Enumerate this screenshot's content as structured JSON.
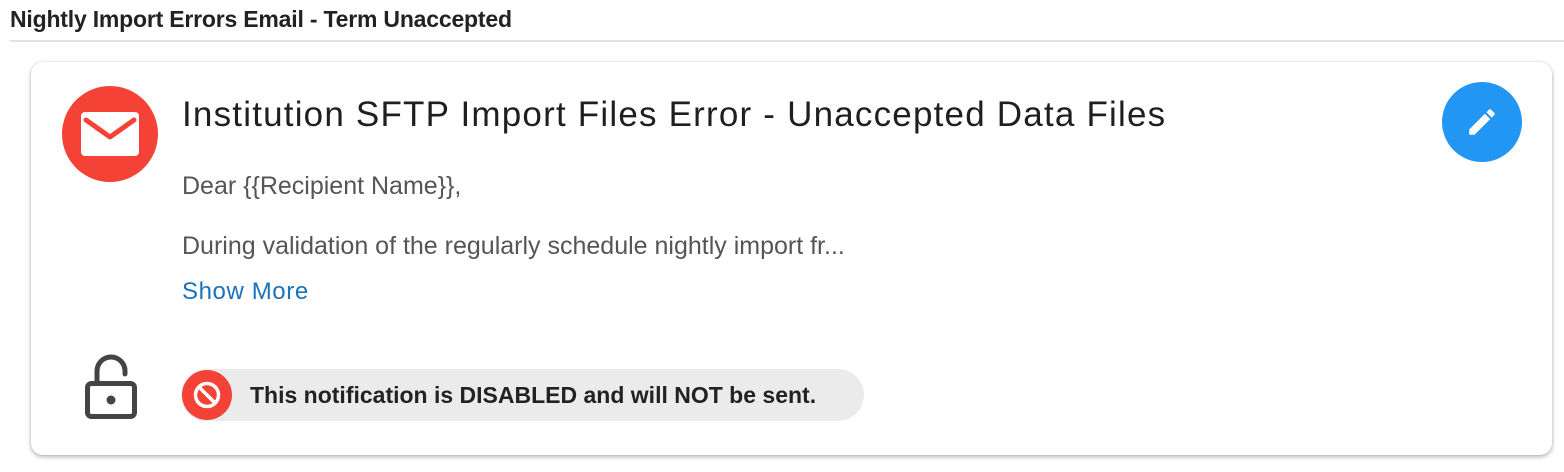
{
  "section": {
    "title": "Nightly Import Errors Email - Term Unaccepted"
  },
  "notification": {
    "icon": "mail-icon",
    "title": "Institution SFTP Import Files Error - Unaccepted Data Files",
    "greeting": "Dear {{Recipient Name}},",
    "excerpt": "During validation of the regularly schedule nightly import fr...",
    "show_more_label": "Show More",
    "edit_icon": "pencil-icon",
    "lock_icon": "lock-open-icon",
    "status": {
      "icon": "block-icon",
      "text": "This notification is DISABLED and will NOT be sent."
    }
  },
  "colors": {
    "mail_badge": "#f44336",
    "edit_button": "#2196f3",
    "link": "#1a73b8",
    "status_chip_bg": "#ebebeb",
    "status_icon": "#f44336"
  }
}
